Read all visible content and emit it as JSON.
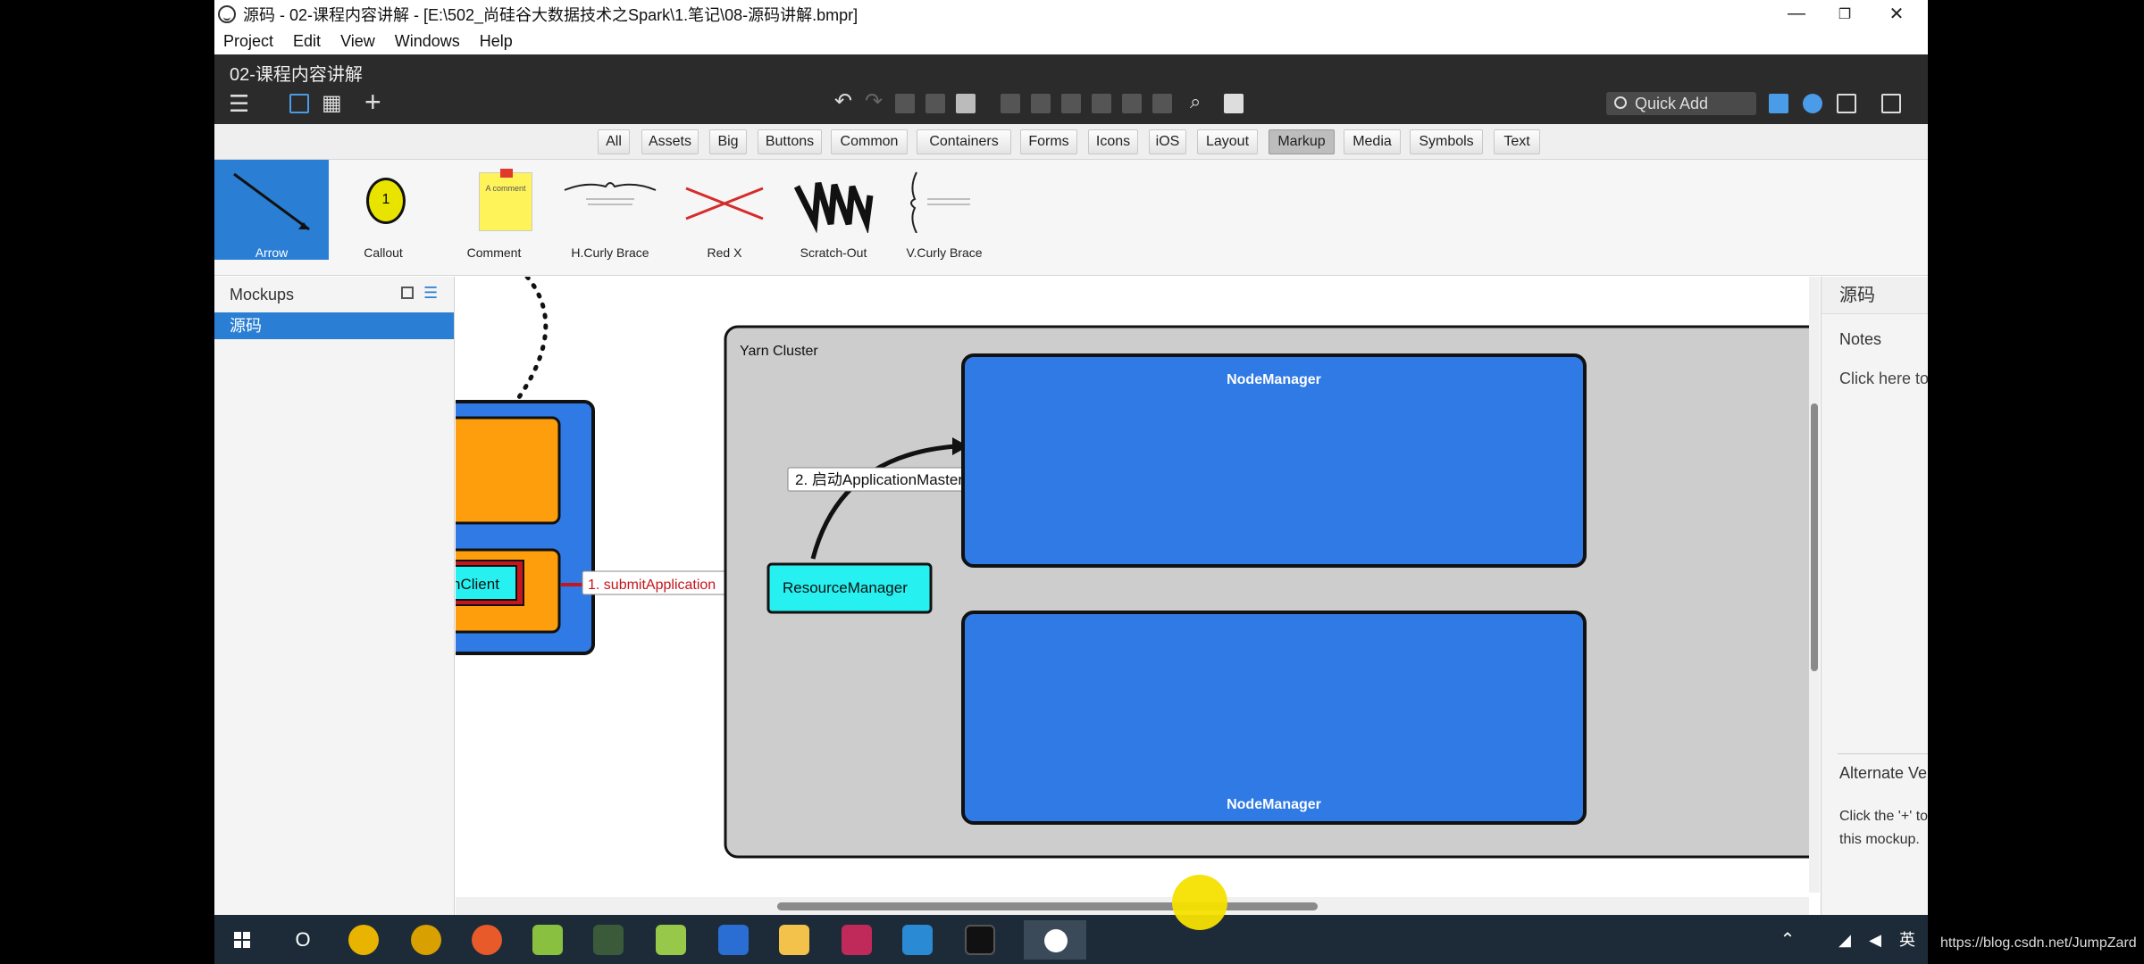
{
  "window": {
    "title": "源码 - 02-课程内容讲解 - [E:\\502_尚硅谷大数据技术之Spark\\1.笔记\\08-源码讲解.bmpr]",
    "minimize": "—",
    "maximize": "❐",
    "close": "✕"
  },
  "menu": [
    "Project",
    "Edit",
    "View",
    "Windows",
    "Help"
  ],
  "doc": {
    "title": "02-课程内容讲解",
    "quick_add_placeholder": "Quick Add"
  },
  "filters": [
    "All",
    "Assets",
    "Big",
    "Buttons",
    "Common",
    "Containers",
    "Forms",
    "Icons",
    "iOS",
    "Layout",
    "Markup",
    "Media",
    "Symbols",
    "Text"
  ],
  "active_filter": "Markup",
  "library": {
    "items": [
      "Arrow",
      "Callout",
      "Comment",
      "H.Curly Brace",
      "Red X",
      "Scratch-Out",
      "V.Curly Brace"
    ],
    "selected": "Arrow",
    "callout_number": "1",
    "comment_text": "A comment",
    "brace_text": "A paragraph of text.\nA second row of text."
  },
  "left_panel": {
    "title": "Mockups",
    "items": [
      "源码"
    ]
  },
  "canvas": {
    "client_label": "nClient",
    "submit_label": "1. submitApplication",
    "yarn_cluster_label": "Yarn Cluster",
    "resource_manager_label": "ResourceManager",
    "launch_am_label": "2. 启动ApplicationMaster",
    "node_manager_top": "NodeManager",
    "node_manager_bottom": "NodeManager"
  },
  "right_panel": {
    "title": "源码",
    "notes_label": "Notes",
    "notes_hint": "Click here to edit notes.",
    "alt_versions_label": "Alternate Versions",
    "alt_versions_help": "?",
    "alt_versions_add": "+",
    "alt_versions_hint": "Click the '+' to create an alternate version of this mockup."
  },
  "taskbar": {
    "language": "英",
    "search_icon_glyph": "O"
  },
  "watermark": "https://blog.csdn.net/JumpZard",
  "colors": {
    "node_blue": "#2f7ae5",
    "rm_cyan": "#27f0f0",
    "client_orange": "#ff9e0d",
    "submit_red": "#c4161c",
    "cluster_gray": "#cdcdcd",
    "accent_blue": "#2a7fd4"
  }
}
